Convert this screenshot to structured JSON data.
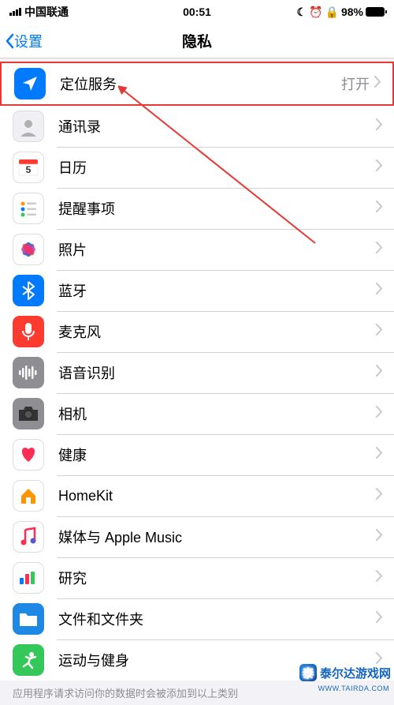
{
  "status": {
    "carrier": "中国联通",
    "time": "00:51",
    "battery_pct": "98%"
  },
  "nav": {
    "back_label": "设置",
    "title": "隐私"
  },
  "highlighted_row": {
    "label": "定位服务",
    "value": "打开"
  },
  "rows": [
    {
      "key": "contacts",
      "label": "通讯录"
    },
    {
      "key": "calendar",
      "label": "日历"
    },
    {
      "key": "reminders",
      "label": "提醒事项"
    },
    {
      "key": "photos",
      "label": "照片"
    },
    {
      "key": "bluetooth",
      "label": "蓝牙"
    },
    {
      "key": "microphone",
      "label": "麦克风"
    },
    {
      "key": "speech",
      "label": "语音识别"
    },
    {
      "key": "camera",
      "label": "相机"
    },
    {
      "key": "health",
      "label": "健康"
    },
    {
      "key": "homekit",
      "label": "HomeKit"
    },
    {
      "key": "media",
      "label": "媒体与 Apple Music"
    },
    {
      "key": "research",
      "label": "研究"
    },
    {
      "key": "files",
      "label": "文件和文件夹"
    },
    {
      "key": "fitness",
      "label": "运动与健身"
    }
  ],
  "footer": "应用程序请求访问你的数据时会被添加到以上类别",
  "icons": {
    "location": {
      "bg": "#007aff"
    },
    "contacts": {
      "bg": "#efeff4"
    },
    "calendar": {
      "bg": "#ffffff"
    },
    "reminders": {
      "bg": "#ffffff"
    },
    "photos": {
      "bg": "#ffffff"
    },
    "bluetooth": {
      "bg": "#007aff"
    },
    "microphone": {
      "bg": "#ff3b30"
    },
    "speech": {
      "bg": "#8e8e93"
    },
    "camera": {
      "bg": "#8e8e93"
    },
    "health": {
      "bg": "#ffffff"
    },
    "homekit": {
      "bg": "#ffffff"
    },
    "media": {
      "bg": "#ffffff"
    },
    "research": {
      "bg": "#ffffff"
    },
    "files": {
      "bg": "#1e88e5"
    },
    "fitness": {
      "bg": "#34c759"
    }
  },
  "watermark": {
    "text": "泰尔达游戏网",
    "url": "WWW.TAIRDA.COM",
    "logo_char": "泰"
  }
}
